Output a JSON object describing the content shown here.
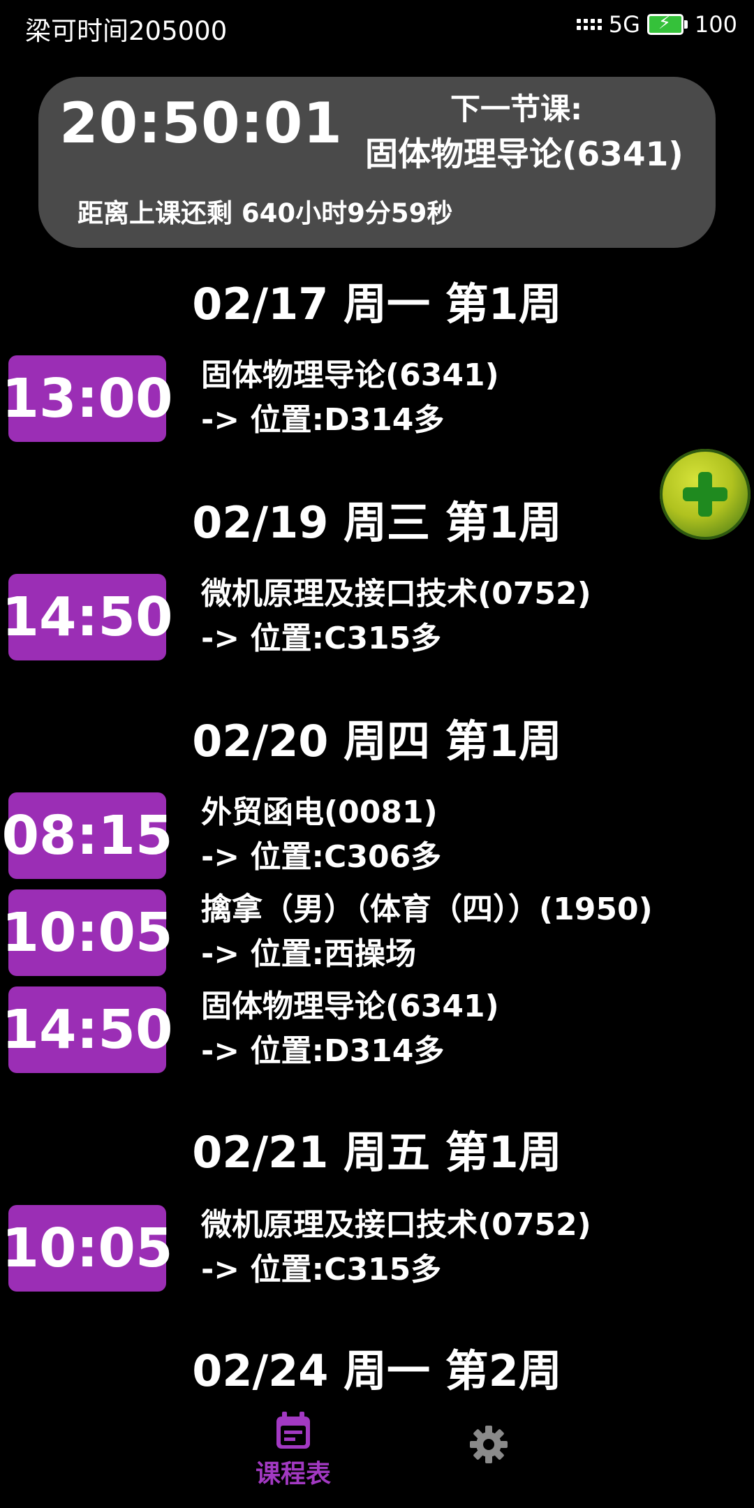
{
  "status_bar": {
    "left_text": "梁可时间205000",
    "network": "5G",
    "battery": "100"
  },
  "next_card": {
    "clock": "20:50:01",
    "next_label": "下一节课:",
    "next_course": "固体物理导论(6341)",
    "countdown": "距离上课还剩 640小时9分59秒"
  },
  "days": [
    {
      "header": "02/17 周一 第1周",
      "classes": [
        {
          "time": "13:00",
          "name": "固体物理导论(6341)",
          "location": "-> 位置:D314多"
        }
      ]
    },
    {
      "header": "02/19 周三 第1周",
      "classes": [
        {
          "time": "14:50",
          "name": "微机原理及接口技术(0752)",
          "location": "-> 位置:C315多"
        }
      ]
    },
    {
      "header": "02/20 周四 第1周",
      "classes": [
        {
          "time": "08:15",
          "name": "外贸函电(0081)",
          "location": "-> 位置:C306多"
        },
        {
          "time": "10:05",
          "name": "擒拿（男）（体育（四））(1950)",
          "location": "-> 位置:西操场"
        },
        {
          "time": "14:50",
          "name": "固体物理导论(6341)",
          "location": "-> 位置:D314多"
        }
      ]
    },
    {
      "header": "02/21 周五 第1周",
      "classes": [
        {
          "time": "10:05",
          "name": "微机原理及接口技术(0752)",
          "location": "-> 位置:C315多"
        }
      ]
    },
    {
      "header": "02/24 周一 第2周",
      "classes": []
    }
  ],
  "bottom_nav": {
    "schedule_label": "课程表",
    "schedule_icon": "calendar-icon",
    "settings_icon": "gear-icon"
  },
  "colors": {
    "accent": "#9b2eb5",
    "card_bg": "#4a4a4a",
    "background": "#000000"
  }
}
